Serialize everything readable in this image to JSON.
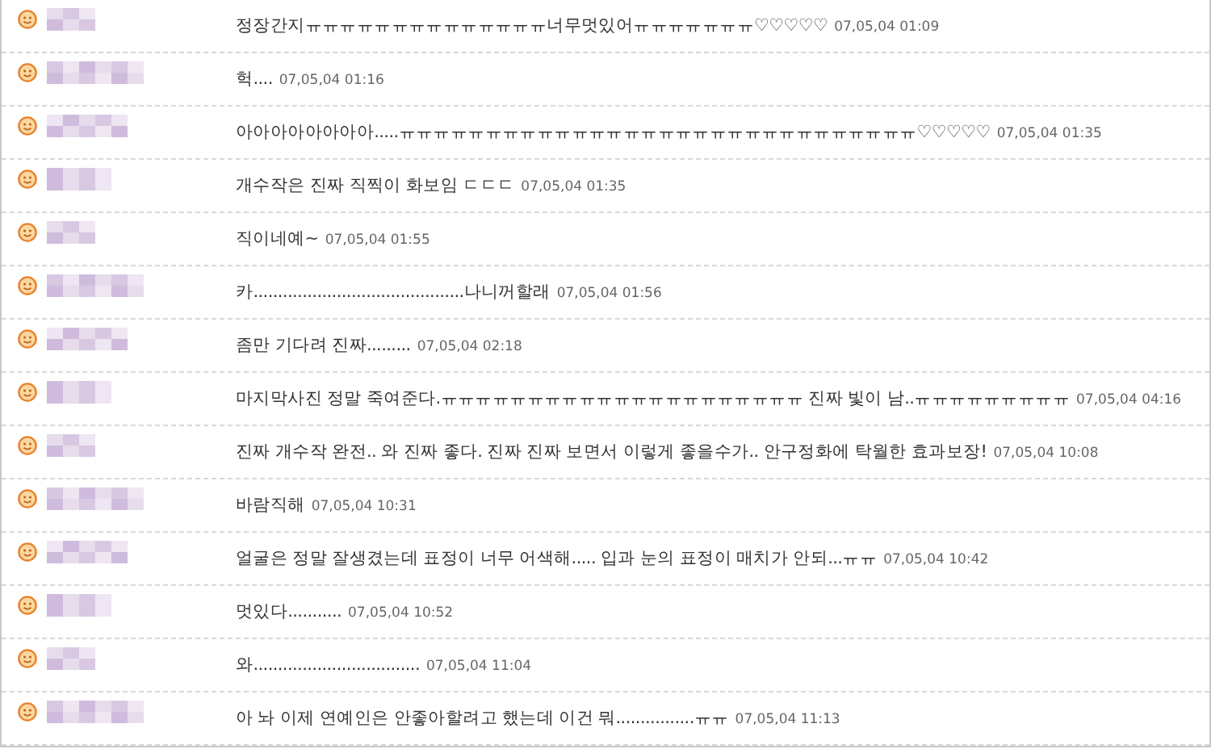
{
  "comments": [
    {
      "text": "정장간지ㅠㅠㅠㅠㅠㅠㅠㅠㅠㅠㅠㅠㅠㅠ너무멋있어ㅠㅠㅠㅠㅠㅠㅠ♡♡♡♡♡",
      "time": "07,05,04 01:09"
    },
    {
      "text": "헉....",
      "time": "07,05,04 01:16"
    },
    {
      "text": "아아아아아아아아.....ㅠㅠㅠㅠㅠㅠㅠㅠㅠㅠㅠㅠㅠㅠㅠㅠㅠㅠㅠㅠㅠㅠㅠㅠㅠㅠㅠㅠㅠㅠ♡♡♡♡♡",
      "time": "07,05,04 01:35"
    },
    {
      "text": "개수작은 진짜 직찍이 화보임 ㄷㄷㄷ",
      "time": "07,05,04 01:35"
    },
    {
      "text": "직이네예~",
      "time": "07,05,04 01:55"
    },
    {
      "text": "카...........................................나니꺼할래",
      "time": "07,05,04 01:56"
    },
    {
      "text": "좀만 기다려 진짜.........",
      "time": "07,05,04 02:18"
    },
    {
      "text": "마지막사진 정말 죽여준다.ㅠㅠㅠㅠㅠㅠㅠㅠㅠㅠㅠㅠㅠㅠㅠㅠㅠㅠㅠㅠㅠ 진짜 빛이 남..ㅠㅠㅠㅠㅠㅠㅠㅠㅠ",
      "time": "07,05,04 04:16"
    },
    {
      "text": "진짜 개수작 완전.. 와 진짜 좋다. 진짜 진짜 보면서 이렇게 좋을수가.. 안구정화에 탁월한 효과보장!",
      "time": "07,05,04 10:08"
    },
    {
      "text": "바람직해",
      "time": "07,05,04 10:31"
    },
    {
      "text": "얼굴은 정말 잘생겼는데 표정이 너무 어색해..... 입과 눈의 표정이 매치가 안되...ㅠㅠ",
      "time": "07,05,04 10:42"
    },
    {
      "text": "멋있다...........",
      "time": "07,05,04 10:52"
    },
    {
      "text": "와..................................",
      "time": "07,05,04 11:04"
    },
    {
      "text": "아 놔 이제 연예인은 안좋아할려고 했는데 이건 뭐................ㅠㅠ",
      "time": "07,05,04 11:13"
    }
  ]
}
